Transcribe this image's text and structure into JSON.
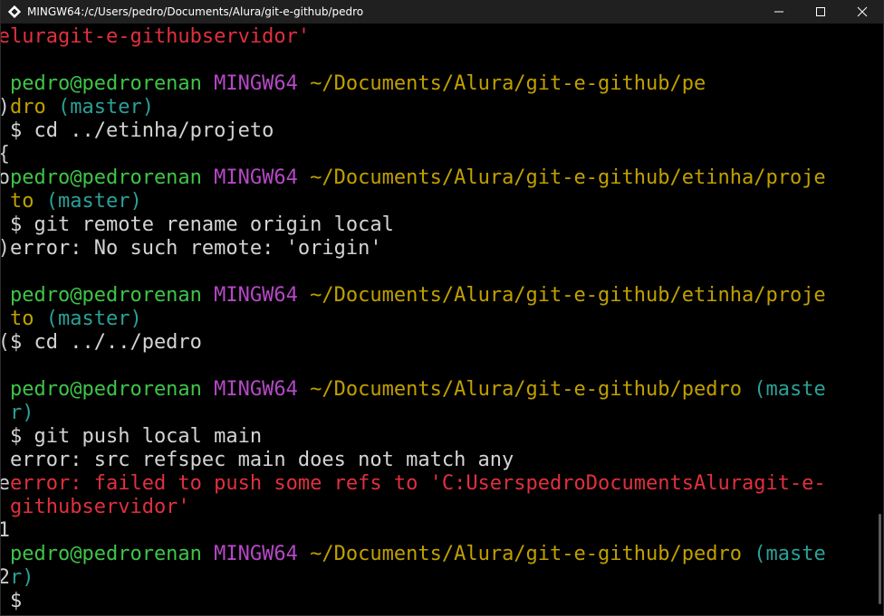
{
  "window": {
    "title": "MINGW64:/c/Users/pedro/Documents/Alura/git-e-github/pedro",
    "minimize_glyph": "—",
    "maximize_glyph": "☐",
    "close_glyph": "✕"
  },
  "colors": {
    "background": "#000000",
    "user_host": "#3fc449",
    "mingw": "#b548c6",
    "path": "#c0a000",
    "branch": "#2aa198",
    "error": "#e0303e",
    "text": "#d4d4d4"
  },
  "terminal": {
    "lines": [
      {
        "t": "err1",
        "text": "luragit-e-githubservidor'"
      },
      {
        "t": "blank"
      },
      {
        "t": "p1a_user",
        "user": "pedro@pedrorenan",
        "sys": "MINGW64",
        "path": "~/Documents/Alura/git-e-github/pe"
      },
      {
        "t": "p1b",
        "path": "dro",
        "branch": "(master)"
      },
      {
        "t": "cmd",
        "text": "$ cd ../etinha/projeto"
      },
      {
        "t": "blank"
      },
      {
        "t": "p2a_user",
        "user": "pedro@pedrorenan",
        "sys": "MINGW64",
        "path": "~/Documents/Alura/git-e-github/etinha/proje"
      },
      {
        "t": "p2b",
        "path": "to",
        "branch": "(master)"
      },
      {
        "t": "cmd",
        "text": "$ git remote rename origin local"
      },
      {
        "t": "out",
        "text": "error: No such remote: 'origin'"
      },
      {
        "t": "blank"
      },
      {
        "t": "p3a_user",
        "user": "pedro@pedrorenan",
        "sys": "MINGW64",
        "path": "~/Documents/Alura/git-e-github/etinha/proje"
      },
      {
        "t": "p3b",
        "path": "to",
        "branch": "(master)"
      },
      {
        "t": "cmd",
        "text": "$ cd ../../pedro"
      },
      {
        "t": "blank"
      },
      {
        "t": "p4a_user",
        "user": "pedro@pedrorenan",
        "sys": "MINGW64",
        "path": "~/Documents/Alura/git-e-github/pedro",
        "branch": "(maste"
      },
      {
        "t": "p4b",
        "branch": "r)"
      },
      {
        "t": "cmd",
        "text": "$ git push local main"
      },
      {
        "t": "out",
        "text": "error: src refspec main does not match any"
      },
      {
        "t": "err",
        "text": "error: failed to push some refs to 'C:UserspedroDocumentsAluragit-e-"
      },
      {
        "t": "err",
        "text": "githubservidor'"
      },
      {
        "t": "blank"
      },
      {
        "t": "p5a_user",
        "user": "pedro@pedrorenan",
        "sys": "MINGW64",
        "path": "~/Documents/Alura/git-e-github/pedro",
        "branch": "(maste"
      },
      {
        "t": "p5b",
        "branch": "r)"
      },
      {
        "t": "cmd",
        "text": "$"
      }
    ],
    "left_edge_fragments": [
      "e",
      "",
      "",
      ")",
      "",
      "{",
      "o",
      "",
      "",
      ")",
      "",
      "",
      "",
      "(",
      "",
      "",
      "",
      "",
      "",
      "e",
      "",
      "1",
      "",
      "2",
      "",
      ""
    ]
  }
}
